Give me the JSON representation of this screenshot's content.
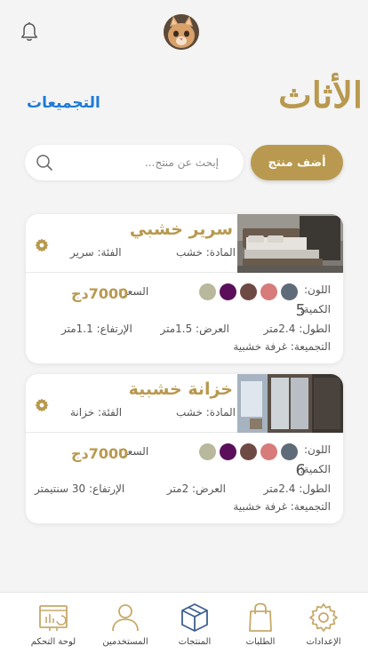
{
  "header": {
    "title": "الأثاث",
    "collections_link": "التجميعات"
  },
  "search": {
    "placeholder": "إبحث عن منتج...",
    "add_button": "أضف منتج"
  },
  "products": [
    {
      "name": "سرير خشبي",
      "material": "المادة: خشب",
      "category": "الفئة: سرير",
      "colors_label": "اللون:",
      "colors": [
        "#5f6b78",
        "#d77b7b",
        "#6e4a45",
        "#5b0f5a",
        "#b8b89c"
      ],
      "price_label": "السعر:",
      "price": "7000دج",
      "quantity_label": "الكمية:",
      "quantity": "5",
      "length": "الطول: 2.4متر",
      "width": "العرض: 1.5متر",
      "height": "الإرتفاع: 1.1متر",
      "collection": "التجميعة: غرفة خشبية"
    },
    {
      "name": "خزانة خشبية",
      "material": "المادة: خشب",
      "category": "الفئة: خزانة",
      "colors_label": "اللون:",
      "colors": [
        "#5f6b78",
        "#d77b7b",
        "#6e4a45",
        "#5b0f5a",
        "#b8b89c"
      ],
      "price_label": "السعر:",
      "price": "7000دج",
      "quantity_label": "الكمية:",
      "quantity": "6",
      "length": "الطول: 2.4متر",
      "width": "العرض: 2متر",
      "height": "الإرتفاع: 30 سنتيمتر",
      "collection": "التجميعة: غرفة خشبية"
    }
  ],
  "nav": {
    "settings": "الإعدادات",
    "orders": "الطلبات",
    "products": "المنتجات",
    "users": "المستخدمين",
    "dashboard": "لوحة التحكم"
  },
  "colors": {
    "accent": "#b8994f",
    "link": "#1d7bd6",
    "nav_icon": "#c7a96a",
    "nav_icon_active": "#3e5f8e"
  },
  "icons": {
    "bell": "bell-icon",
    "search": "search-icon",
    "gear": "gear-icon",
    "settings": "settings-icon",
    "orders": "shopping-bag-icon",
    "products": "box-icon",
    "users": "user-icon",
    "dashboard": "dashboard-icon"
  }
}
